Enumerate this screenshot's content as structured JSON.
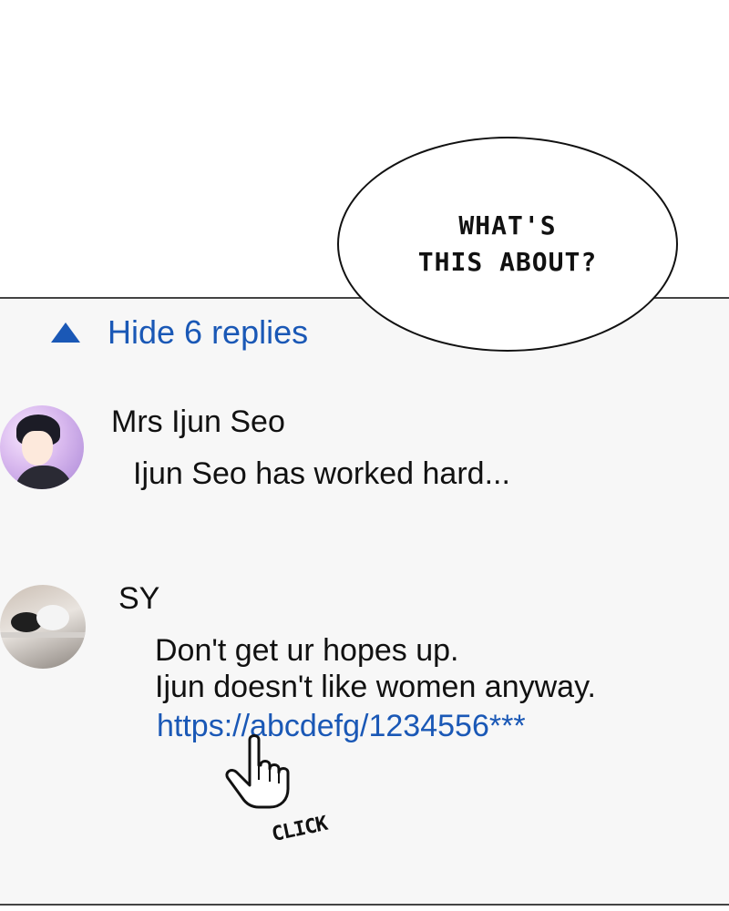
{
  "bubble": {
    "lines": [
      "WHAT'S",
      "THIS ABOUT?"
    ]
  },
  "thread": {
    "hide_replies_label": "Hide 6 replies",
    "accent_color": "#1a58b6"
  },
  "comments": [
    {
      "author": "Mrs Ijun Seo",
      "text_lines": [
        "Ijun Seo has worked hard..."
      ]
    },
    {
      "author": "SY",
      "text_lines": [
        "Don't get ur hopes up.",
        "Ijun doesn't like women anyway."
      ],
      "link": "https://abcdefg/1234556***"
    }
  ],
  "sfx": {
    "click": "CLICK"
  },
  "icons": {
    "toggle": "triangle-up-icon",
    "cursor": "pointer-hand-icon"
  }
}
